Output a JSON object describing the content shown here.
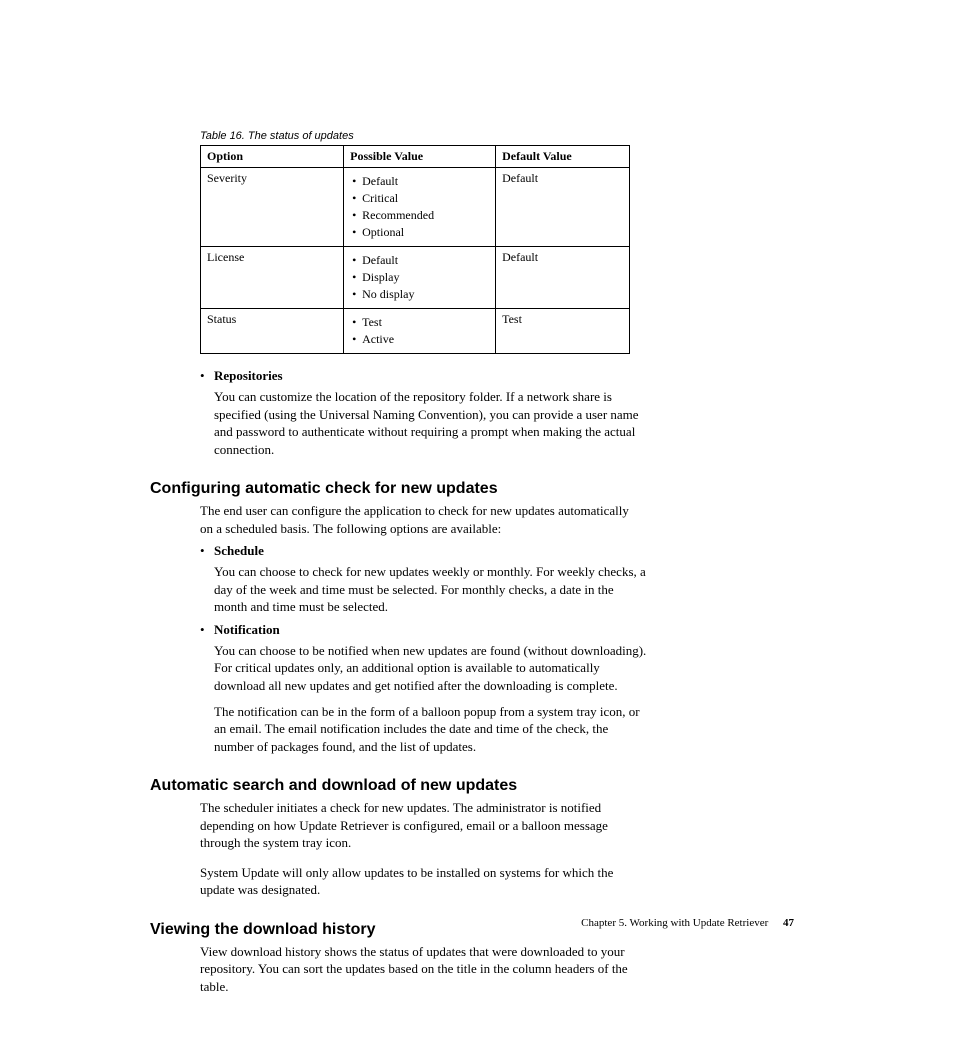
{
  "table": {
    "caption": "Table 16. The status of updates",
    "headers": {
      "option": "Option",
      "possible": "Possible Value",
      "default": "Default Value"
    },
    "rows": [
      {
        "option": "Severity",
        "possible": [
          "Default",
          "Critical",
          "Recommended",
          "Optional"
        ],
        "default": "Default"
      },
      {
        "option": "License",
        "possible": [
          "Default",
          "Display",
          "No display"
        ],
        "default": "Default"
      },
      {
        "option": "Status",
        "possible": [
          "Test",
          "Active"
        ],
        "default": "Test"
      }
    ]
  },
  "repositories": {
    "title": "Repositories",
    "body": "You can customize the location of the repository folder. If a network share is specified (using the Universal Naming Convention), you can provide a user name and password to authenticate without requiring a prompt when making the actual connection."
  },
  "sec1": {
    "heading": "Configuring automatic check for new updates",
    "intro": "The end user can configure the application to check for new updates automatically on a scheduled basis. The following options are available:",
    "items": [
      {
        "title": "Schedule",
        "body": "You can choose to check for new updates weekly or monthly. For weekly checks, a day of the week and time must be selected. For monthly checks, a date in the month and time must be selected."
      },
      {
        "title": "Notification",
        "body1": "You can choose to be notified when new updates are found (without downloading). For critical updates only, an additional option is available to automatically download all new updates and get notified after the downloading is complete.",
        "body2": "The notification can be in the form of a balloon popup from a system tray icon, or an email. The email notification includes the date and time of the check, the number of packages found, and the list of updates."
      }
    ]
  },
  "sec2": {
    "heading": "Automatic search and download of new updates",
    "p1": "The scheduler initiates a check for new updates. The administrator is notified depending on how Update Retriever is configured, email or a balloon message through the system tray icon.",
    "p2": "System Update will only allow updates to be installed on systems for which the update was designated."
  },
  "sec3": {
    "heading": "Viewing the download history",
    "p1": "View download history shows the status of updates that were downloaded to your repository. You can sort the updates based on the title in the column headers of the table."
  },
  "footer": {
    "chapter": "Chapter 5. Working with Update Retriever",
    "page": "47"
  }
}
